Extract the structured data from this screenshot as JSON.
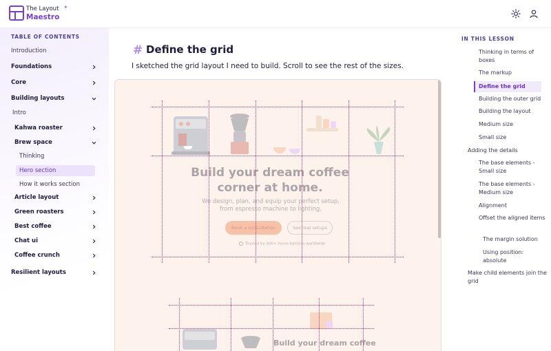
{
  "header": {
    "logo_top": "The Layout",
    "logo_bottom": "Maestro",
    "theme_toggle_label": "Toggle theme",
    "account_label": "Account"
  },
  "sidebar": {
    "heading": "TABLE OF CONTENTS",
    "items": [
      {
        "label": "Introduction"
      },
      {
        "label": "Foundations"
      },
      {
        "label": "Core"
      },
      {
        "label": "Building layouts"
      },
      {
        "label": "Intro"
      },
      {
        "label": "Kahwa roaster"
      },
      {
        "label": "Brew space"
      },
      {
        "label": "Thinking"
      },
      {
        "label": "Hero section"
      },
      {
        "label": "How it works section"
      },
      {
        "label": "Article layout"
      },
      {
        "label": "Green roasters"
      },
      {
        "label": "Best coffee"
      },
      {
        "label": "Chat ui"
      },
      {
        "label": "Coffee crunch"
      },
      {
        "label": "Resilient layouts"
      }
    ]
  },
  "main": {
    "hash": "#",
    "title": "Define the grid",
    "lead": "I sketched the grid layout I need to build. Scroll to see the rest of the sizes.",
    "demo": {
      "hero_title": "Build your dream coffee corner at home.",
      "hero_subtitle": "We design, plan, and equip your perfect setup, from espresso machine to lighting.",
      "primary_button": "Book a consultation",
      "secondary_button": "See real setups",
      "trust_text": "Trusted by 500+ home baristas worldwide",
      "second_title": "Build your dream coffee"
    }
  },
  "lesson_toc": {
    "heading": "IN THIS LESSON",
    "items": [
      {
        "label": "Thinking in terms of boxes"
      },
      {
        "label": "The markup"
      },
      {
        "label": "Define the grid"
      },
      {
        "label": "Building the outer grid"
      },
      {
        "label": "Building the layout"
      },
      {
        "label": "Medium size"
      },
      {
        "label": "Small size"
      },
      {
        "label": "Adding the details"
      },
      {
        "label": "The base elements - Small size"
      },
      {
        "label": "The base elements - Medium size"
      },
      {
        "label": "Alignment"
      },
      {
        "label": "Offset the aligned items"
      },
      {
        "label": "The margin solution"
      },
      {
        "label": "Using position: absolute"
      },
      {
        "label": "Make child elements join the grid"
      }
    ]
  },
  "colors": {
    "accent": "#7a3fc4",
    "grid_line": "#d02a7c",
    "demo_bg": "#fdece3"
  }
}
